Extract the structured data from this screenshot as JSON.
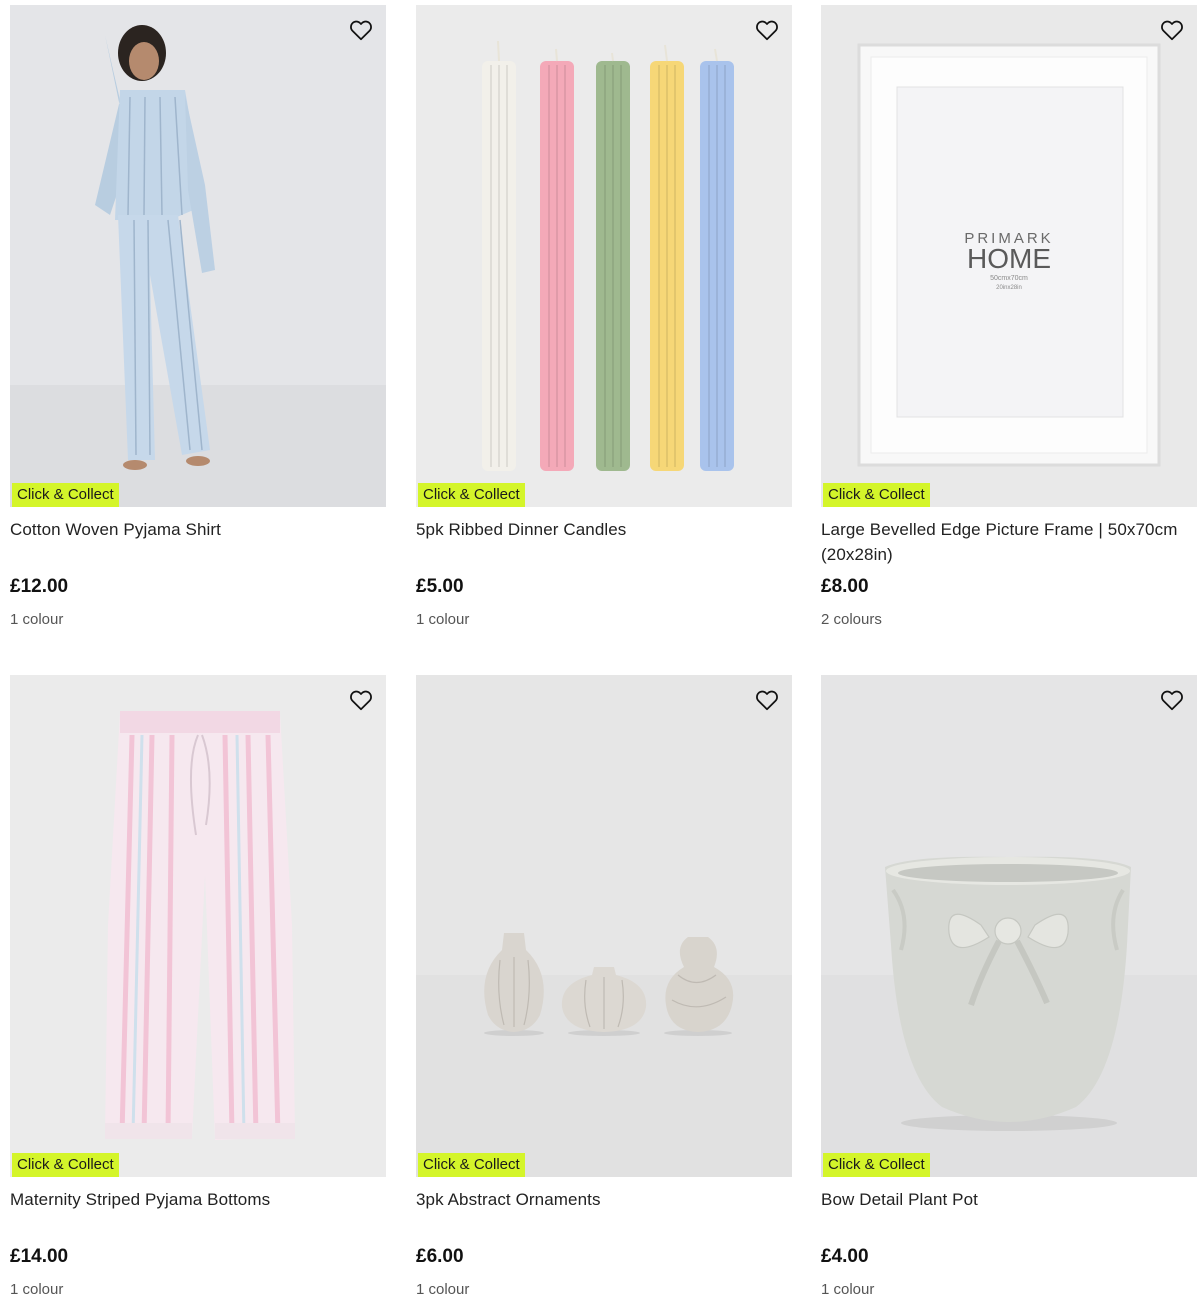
{
  "products": [
    {
      "title": "Cotton Woven Pyjama Shirt",
      "price": "£12.00",
      "colours": "1 colour",
      "badge": "Click & Collect",
      "icon": "heart-outline-icon"
    },
    {
      "title": "5pk Ribbed Dinner Candles",
      "price": "£5.00",
      "colours": "1 colour",
      "badge": "Click & Collect",
      "icon": "heart-outline-icon"
    },
    {
      "title": "Large Bevelled Edge Picture Frame | 50x70cm (20x28in)",
      "price": "£8.00",
      "colours": "2 colours",
      "badge": "Click & Collect",
      "icon": "heart-outline-icon",
      "image_text": {
        "brand": "PRIMARK",
        "brand_sub": "HOME",
        "size_cm": "50cmx70cm",
        "size_in": "20inx28in"
      }
    },
    {
      "title": "Maternity Striped Pyjama Bottoms",
      "price": "£14.00",
      "colours": "1 colour",
      "badge": "Click & Collect",
      "icon": "heart-outline-icon"
    },
    {
      "title": "3pk Abstract Ornaments",
      "price": "£6.00",
      "colours": "1 colour",
      "badge": "Click & Collect",
      "icon": "heart-outline-icon"
    },
    {
      "title": "Bow Detail Plant Pot",
      "price": "£4.00",
      "colours": "1 colour",
      "badge": "Click & Collect",
      "icon": "heart-outline-icon"
    }
  ],
  "colors": {
    "badge_bg": "#d4f52a",
    "image_bg": "#e8e8ea"
  }
}
